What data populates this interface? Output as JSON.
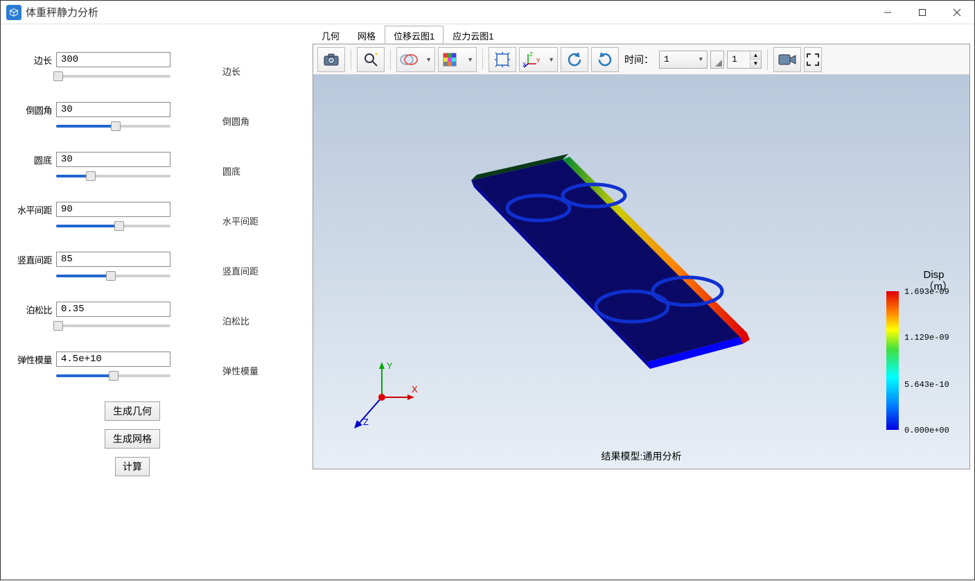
{
  "window": {
    "title": "体重秤静力分析"
  },
  "params": [
    {
      "label_left": "边长",
      "value": "300",
      "label_right": "边长",
      "fill": 2,
      "thumb": 2
    },
    {
      "label_left": "倒圆角",
      "value": "30",
      "label_right": "倒圆角",
      "fill": 52,
      "thumb": 52
    },
    {
      "label_left": "圆底",
      "value": "30",
      "label_right": "圆底",
      "fill": 30,
      "thumb": 30
    },
    {
      "label_left": "水平间距",
      "value": "90",
      "label_right": "水平间距",
      "fill": 55,
      "thumb": 55
    },
    {
      "label_left": "竖直间距",
      "value": "85",
      "label_right": "竖直间距",
      "fill": 48,
      "thumb": 48
    },
    {
      "label_left": "泊松比",
      "value": "0.35",
      "label_right": "泊松比",
      "fill": 2,
      "thumb": 2
    },
    {
      "label_left": "弹性模量",
      "value": "4.5e+10",
      "label_right": "弹性模量",
      "fill": 50,
      "thumb": 50
    }
  ],
  "buttons": {
    "generate_geometry": "生成几何",
    "generate_mesh": "生成网格",
    "compute": "计算"
  },
  "tabs": [
    "几何",
    "网格",
    "位移云图1",
    "应力云图1"
  ],
  "active_tab": 2,
  "toolbar": {
    "time_label": "时间：",
    "time_value": "1",
    "spin_value": "1"
  },
  "viewport": {
    "caption": "结果模型:通用分析",
    "legend": {
      "title_line1": "Disp",
      "title_line2": "（m）",
      "ticks": [
        {
          "pos": 0,
          "text": "1.693e-09"
        },
        {
          "pos": 33,
          "text": "1.129e-09"
        },
        {
          "pos": 67,
          "text": "5.643e-10"
        },
        {
          "pos": 100,
          "text": "0.000e+00"
        }
      ]
    },
    "axes": {
      "x": "X",
      "y": "Y",
      "z": "Z"
    }
  }
}
